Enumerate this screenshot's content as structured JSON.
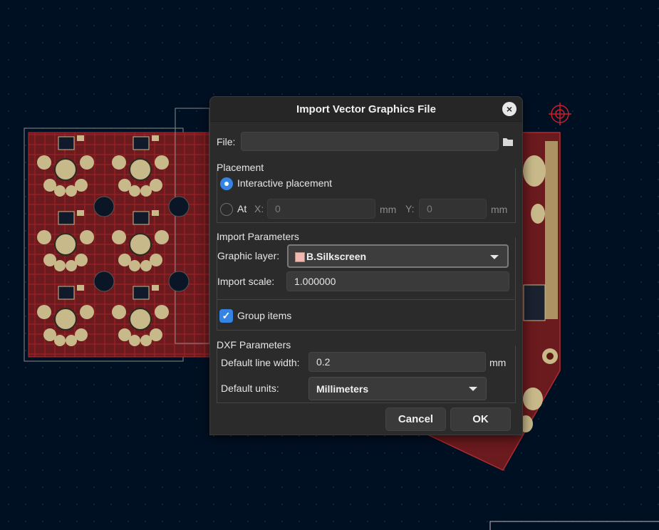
{
  "dialog": {
    "title": "Import Vector Graphics File",
    "close_glyph": "×",
    "file": {
      "label": "File:",
      "value": "",
      "browse_icon": "folder-icon"
    },
    "placement": {
      "heading": "Placement",
      "interactive_label": "Interactive placement",
      "interactive_selected": true,
      "at_label": "At",
      "x_label": "X:",
      "x_value": "0",
      "x_unit": "mm",
      "y_label": "Y:",
      "y_value": "0",
      "y_unit": "mm"
    },
    "import_params": {
      "heading": "Import Parameters",
      "layer_label": "Graphic layer:",
      "layer_value": "B.Silkscreen",
      "layer_color": "#f0b8b0",
      "scale_label": "Import scale:",
      "scale_value": "1.000000",
      "group_label": "Group items",
      "group_checked": true
    },
    "dxf": {
      "heading": "DXF Parameters",
      "line_width_label": "Default line width:",
      "line_width_value": "0.2",
      "line_width_unit": "mm",
      "units_label": "Default units:",
      "units_value": "Millimeters"
    },
    "buttons": {
      "cancel": "Cancel",
      "ok": "OK"
    }
  },
  "colors": {
    "canvas_bg": "#001023",
    "board_copper": "#6b1a1e",
    "pad_gold": "#c8b98a",
    "accent": "#3584e4"
  }
}
